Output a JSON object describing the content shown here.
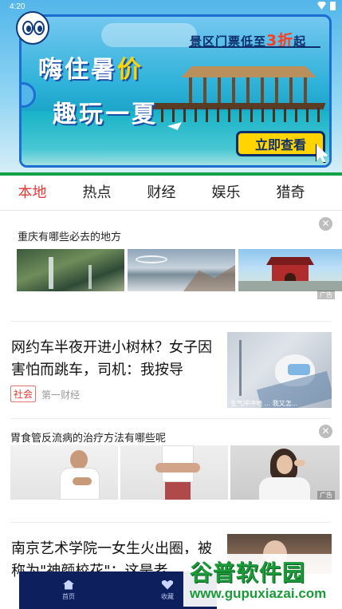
{
  "status_bar": {
    "time": "4:20"
  },
  "banner": {
    "promo_prefix": "景区门票低至",
    "promo_highlight": "3折",
    "promo_suffix": "起",
    "headline_line1_a": "嗨住暑",
    "headline_line1_b": "价",
    "headline_line2": "趣玩一夏",
    "cta_label": "立即查看",
    "colors": {
      "frame": "#1a6fd0",
      "cta_bg": "#ffd400",
      "accent": "#ffd700"
    }
  },
  "tabs": [
    {
      "label": "本地",
      "active": true
    },
    {
      "label": "热点",
      "active": false
    },
    {
      "label": "财经",
      "active": false
    },
    {
      "label": "娱乐",
      "active": false
    },
    {
      "label": "猎奇",
      "active": false
    }
  ],
  "feed": {
    "ad1": {
      "title": "重庆有哪些必去的地方",
      "close_icon": "close-icon",
      "images": [
        "mountain-waterfall",
        "snowy-lake",
        "pagoda-gate"
      ]
    },
    "news1": {
      "title": "网约车半夜开进小树林？女子因害怕而跳车，司机：我按导",
      "tag": "社会",
      "source": "第一财经",
      "thumb_caption": "生气冲冲地 ... 我又怎..."
    },
    "ad2": {
      "title": "胃食管反流病的治疗方法有哪些呢",
      "close_icon": "close-icon",
      "images": [
        "man-chest-pain",
        "stomach-pain",
        "woman-headache"
      ]
    },
    "news2": {
      "title": "南京艺术学院一女生火出圈，被称为\"神颜校花\"：这是老"
    }
  },
  "bottom_nav": [
    {
      "label": "首页",
      "icon": "home-icon"
    },
    {
      "label": "收藏",
      "icon": "heart-icon"
    }
  ],
  "watermark": {
    "main": "谷普软件园",
    "url": "www.gupuxiazai.com"
  }
}
